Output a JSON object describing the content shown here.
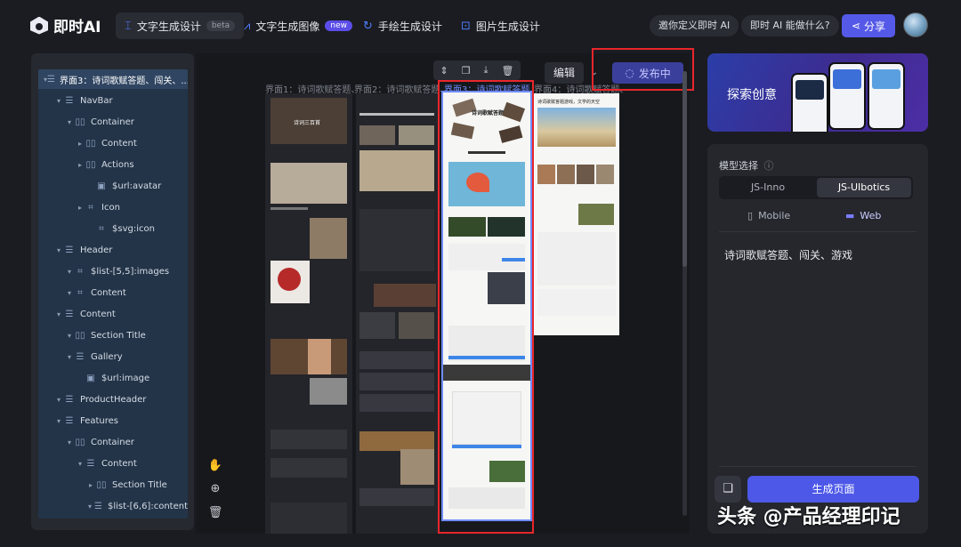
{
  "app": {
    "name": "即时AI"
  },
  "tabs": [
    {
      "label": "文字生成设计",
      "badge": "beta"
    },
    {
      "label": "文字生成图像",
      "badge": "new"
    },
    {
      "label": "手绘生成设计"
    },
    {
      "label": "图片生成设计"
    }
  ],
  "header": {
    "invite_label": "邀你定义即时 AI",
    "about_label": "即时 AI 能做什么?",
    "share_label": "分享"
  },
  "layers": [
    {
      "label": "界面3：诗词歌赋答题、闯关、...",
      "icon": "frame-icon",
      "depth": 0,
      "selected": true
    },
    {
      "label": "NavBar",
      "icon": "frame-icon",
      "depth": 1
    },
    {
      "label": "Container",
      "icon": "columns-icon",
      "depth": 2
    },
    {
      "label": "Content",
      "icon": "columns-icon",
      "depth": 3
    },
    {
      "label": "Actions",
      "icon": "columns-icon",
      "depth": 3
    },
    {
      "label": "$url:avatar",
      "icon": "image-icon",
      "depth": 4
    },
    {
      "label": "Icon",
      "icon": "component-icon",
      "depth": 3
    },
    {
      "label": "$svg:icon",
      "icon": "component-icon",
      "depth": 4
    },
    {
      "label": "Header",
      "icon": "frame-icon",
      "depth": 1
    },
    {
      "label": "$list-[5,5]:images",
      "icon": "component-icon",
      "depth": 2
    },
    {
      "label": "Content",
      "icon": "component-icon",
      "depth": 2
    },
    {
      "label": "Content",
      "icon": "frame-icon",
      "depth": 1
    },
    {
      "label": "Section Title",
      "icon": "columns-icon",
      "depth": 2
    },
    {
      "label": "Gallery",
      "icon": "frame-icon",
      "depth": 2
    },
    {
      "label": "$url:image",
      "icon": "image-icon",
      "depth": 3
    },
    {
      "label": "ProductHeader",
      "icon": "frame-icon",
      "depth": 1
    },
    {
      "label": "Features",
      "icon": "frame-icon",
      "depth": 1
    },
    {
      "label": "Container",
      "icon": "columns-icon",
      "depth": 2
    },
    {
      "label": "Content",
      "icon": "frame-icon",
      "depth": 3
    },
    {
      "label": "Section Title",
      "icon": "columns-icon",
      "depth": 4
    },
    {
      "label": "$list-[6,6]:content",
      "icon": "frame-icon",
      "depth": 4
    }
  ],
  "canvas": {
    "frame_labels": [
      "界面1：诗词歌赋答题、",
      "界面2：诗词歌赋答题、",
      "界面3：诗词歌赋答题、",
      "界面4：诗词歌赋答题、"
    ],
    "edit_label": "编辑",
    "publish_label": "发布中"
  },
  "preview_texts": {
    "f1_title": "诗词三百首",
    "f3_title": "诗词歌赋答题",
    "f4_title": "诗词歌赋答题游戏，文学的天空"
  },
  "settings": {
    "promo_label": "探索创意",
    "model_title": "模型选择",
    "models": [
      "JS-Inno",
      "JS-UIbotics"
    ],
    "selected_model": "JS-UIbotics",
    "devices": [
      "Mobile",
      "Web"
    ],
    "selected_device": "Web",
    "prompt": "诗词歌赋答题、闯关、游戏",
    "generate_label": "生成页面"
  },
  "watermark": "头条 @产品经理印记",
  "colors": {
    "accent": "#4d58e8",
    "highlight_red": "#e8262b",
    "selection_blue": "#6f8cff"
  }
}
